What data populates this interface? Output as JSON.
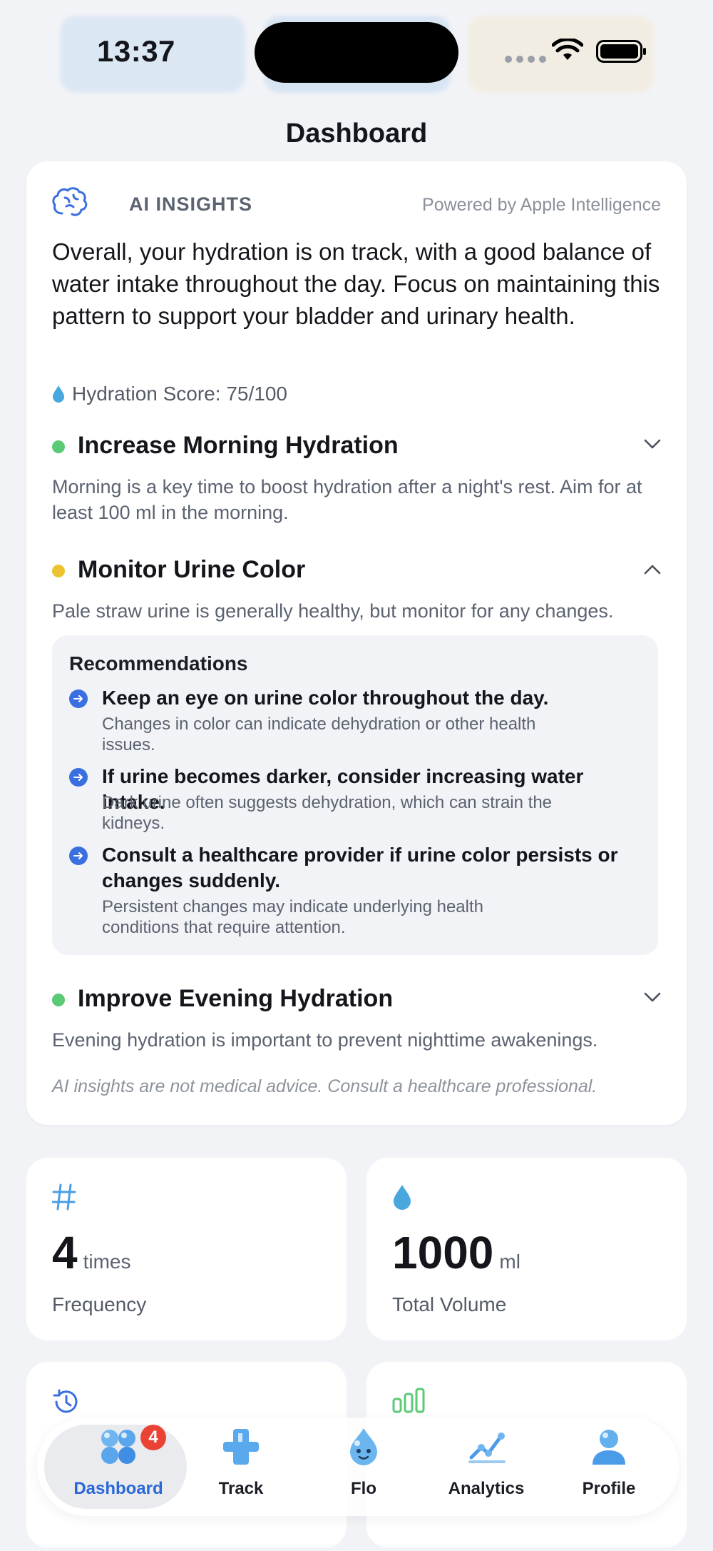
{
  "status_bar": {
    "time": "13:37"
  },
  "page": {
    "title": "Dashboard"
  },
  "ai_card": {
    "label": "AI INSIGHTS",
    "powered_by": "Powered by Apple Intelligence",
    "summary": "Overall, your hydration is on track, with a good balance of water intake throughout the day. Focus on maintaining this pattern to support your bladder and urinary health.",
    "score": "Hydration Score: 75/100",
    "insights": [
      {
        "title": "Increase Morning Hydration",
        "description": "Morning is a key time to boost hydration after a night's rest. Aim for at least 100 ml in the morning.",
        "status_color": "#5cc975",
        "expanded": false
      },
      {
        "title": "Monitor Urine Color",
        "description": "Pale straw urine is generally healthy, but monitor for any changes.",
        "status_color": "#ecc433",
        "expanded": true
      },
      {
        "title": "Improve Evening Hydration",
        "description": "Evening hydration is important to prevent nighttime awakenings.",
        "status_color": "#5cc975",
        "expanded": false
      }
    ],
    "recommendations": {
      "heading": "Recommendations",
      "items": [
        {
          "title": "Keep an eye on urine color throughout the day.",
          "detail": "Changes in color can indicate dehydration or other health issues."
        },
        {
          "title": "If urine becomes darker, consider increasing water intake.",
          "detail": "Dark urine often suggests dehydration, which can strain the kidneys."
        },
        {
          "title": "Consult a healthcare provider if urine color persists or changes suddenly.",
          "detail": "Persistent changes may indicate underlying health conditions that require attention."
        }
      ]
    },
    "disclaimer": "AI insights are not medical advice. Consult a healthcare professional."
  },
  "stats": [
    {
      "value": "4",
      "unit": "times",
      "label": "Frequency",
      "icon": "hash-icon"
    },
    {
      "value": "1000",
      "unit": "ml",
      "label": "Total Volume",
      "icon": "droplet-icon"
    }
  ],
  "tabs": [
    {
      "label": "Dashboard",
      "icon": "dashboard-icon",
      "active": true,
      "badge": "4"
    },
    {
      "label": "Track",
      "icon": "plus-icon"
    },
    {
      "label": "Flo",
      "icon": "flo-droplet-icon"
    },
    {
      "label": "Analytics",
      "icon": "chart-icon"
    },
    {
      "label": "Profile",
      "icon": "person-icon"
    }
  ],
  "colors": {
    "accent": "#3a6fe0",
    "active_tab": "#2a68d8",
    "badge": "#ea4336"
  }
}
